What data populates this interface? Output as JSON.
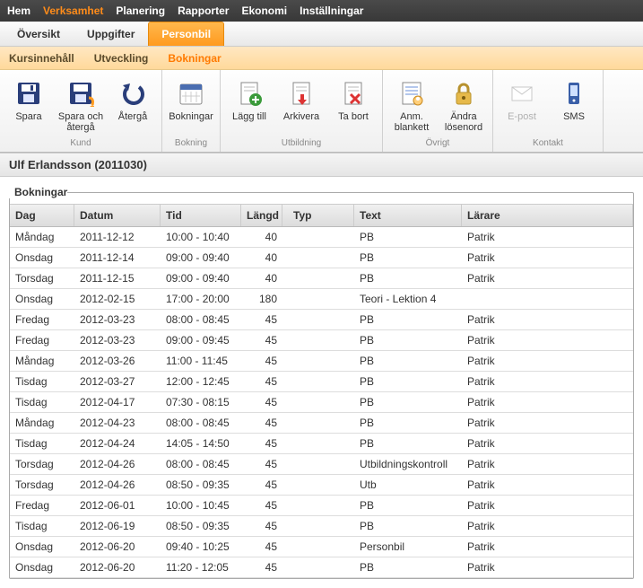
{
  "menubar": [
    "Hem",
    "Verksamhet",
    "Planering",
    "Rapporter",
    "Ekonomi",
    "Inställningar"
  ],
  "menubar_active": 1,
  "tabs": [
    "Översikt",
    "Uppgifter",
    "Personbil"
  ],
  "tabs_active": 2,
  "subtabs": [
    "Kursinnehåll",
    "Utveckling",
    "Bokningar"
  ],
  "subtabs_active": 2,
  "ribbon": {
    "groups": [
      {
        "label": "Kund",
        "buttons": [
          {
            "name": "save-button",
            "icon": "floppy-icon",
            "label": "Spara",
            "disabled": false
          },
          {
            "name": "save-return-button",
            "icon": "floppy-arrow-icon",
            "label": "Spara och återgå",
            "disabled": false
          },
          {
            "name": "return-button",
            "icon": "undo-icon",
            "label": "Återgå",
            "disabled": false
          }
        ]
      },
      {
        "label": "Bokning",
        "buttons": [
          {
            "name": "bookings-button",
            "icon": "calendar-icon",
            "label": "Bokningar",
            "disabled": false
          }
        ]
      },
      {
        "label": "Utbildning",
        "buttons": [
          {
            "name": "add-button",
            "icon": "doc-plus-icon",
            "label": "Lägg till",
            "disabled": false
          },
          {
            "name": "archive-button",
            "icon": "doc-arrow-icon",
            "label": "Arkivera",
            "disabled": false
          },
          {
            "name": "delete-button",
            "icon": "doc-x-icon",
            "label": "Ta bort",
            "disabled": false
          }
        ]
      },
      {
        "label": "Övrigt",
        "buttons": [
          {
            "name": "form-button",
            "icon": "form-icon",
            "label": "Anm. blankett",
            "disabled": false
          },
          {
            "name": "change-password-button",
            "icon": "lock-icon",
            "label": "Ändra lösenord",
            "disabled": false
          }
        ]
      },
      {
        "label": "Kontakt",
        "buttons": [
          {
            "name": "email-button",
            "icon": "envelope-icon",
            "label": "E-post",
            "disabled": true
          },
          {
            "name": "sms-button",
            "icon": "phone-icon",
            "label": "SMS",
            "disabled": false
          }
        ]
      }
    ]
  },
  "entity_title": "Ulf Erlandsson (2011030)",
  "grid": {
    "title": "Bokningar",
    "columns": [
      "Dag",
      "Datum",
      "Tid",
      "Längd",
      "Typ",
      "Text",
      "Lärare"
    ],
    "rows": [
      [
        "Måndag",
        "2011-12-12",
        "10:00 - 10:40",
        "40",
        "",
        "PB",
        "Patrik"
      ],
      [
        "Onsdag",
        "2011-12-14",
        "09:00 - 09:40",
        "40",
        "",
        "PB",
        "Patrik"
      ],
      [
        "Torsdag",
        "2011-12-15",
        "09:00 - 09:40",
        "40",
        "",
        "PB",
        "Patrik"
      ],
      [
        "Onsdag",
        "2012-02-15",
        "17:00 - 20:00",
        "180",
        "",
        "Teori - Lektion 4",
        ""
      ],
      [
        "Fredag",
        "2012-03-23",
        "08:00 - 08:45",
        "45",
        "",
        "PB",
        "Patrik"
      ],
      [
        "Fredag",
        "2012-03-23",
        "09:00 - 09:45",
        "45",
        "",
        "PB",
        "Patrik"
      ],
      [
        "Måndag",
        "2012-03-26",
        "11:00 - 11:45",
        "45",
        "",
        "PB",
        "Patrik"
      ],
      [
        "Tisdag",
        "2012-03-27",
        "12:00 - 12:45",
        "45",
        "",
        "PB",
        "Patrik"
      ],
      [
        "Tisdag",
        "2012-04-17",
        "07:30 - 08:15",
        "45",
        "",
        "PB",
        "Patrik"
      ],
      [
        "Måndag",
        "2012-04-23",
        "08:00 - 08:45",
        "45",
        "",
        "PB",
        "Patrik"
      ],
      [
        "Tisdag",
        "2012-04-24",
        "14:05 - 14:50",
        "45",
        "",
        "PB",
        "Patrik"
      ],
      [
        "Torsdag",
        "2012-04-26",
        "08:00 - 08:45",
        "45",
        "",
        "Utbildningskontroll",
        "Patrik"
      ],
      [
        "Torsdag",
        "2012-04-26",
        "08:50 - 09:35",
        "45",
        "",
        "Utb",
        "Patrik"
      ],
      [
        "Fredag",
        "2012-06-01",
        "10:00 - 10:45",
        "45",
        "",
        "PB",
        "Patrik"
      ],
      [
        "Tisdag",
        "2012-06-19",
        "08:50 - 09:35",
        "45",
        "",
        "PB",
        "Patrik"
      ],
      [
        "Onsdag",
        "2012-06-20",
        "09:40 - 10:25",
        "45",
        "",
        "Personbil",
        "Patrik"
      ],
      [
        "Onsdag",
        "2012-06-20",
        "11:20 - 12:05",
        "45",
        "",
        "PB",
        "Patrik"
      ]
    ]
  }
}
